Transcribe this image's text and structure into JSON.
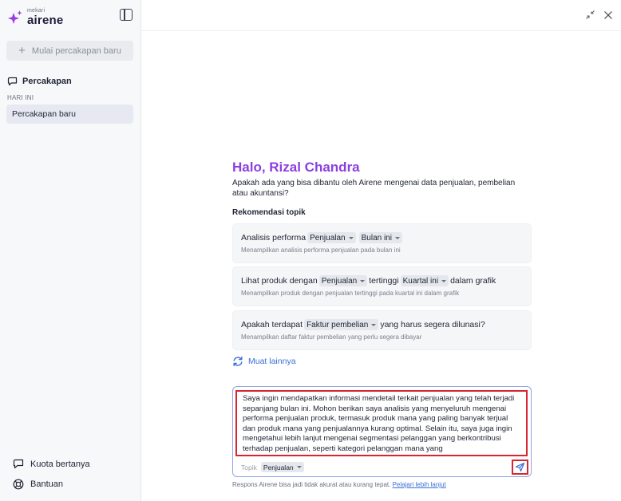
{
  "brand": {
    "small": "mekari",
    "name": "airene",
    "accent": "#8b3fe0"
  },
  "sidebar": {
    "new_chat_label": "Mulai percakapan baru",
    "section_label": "Percakapan",
    "group_label": "HARI INI",
    "conversations": [
      "Percakapan baru"
    ],
    "bottom": {
      "quota_label": "Kuota bertanya",
      "help_label": "Bantuan"
    }
  },
  "main": {
    "greeting": "Halo, Rizal Chandra",
    "subtitle": "Apakah ada yang bisa dibantu oleh Airene mengenai data penjualan, pembelian atau akuntansi?",
    "rec_title": "Rekomendasi topik",
    "cards": [
      {
        "p1": "Analisis performa",
        "chip1": "Penjualan",
        "chip2": "Bulan ini",
        "desc": "Menampilkan analisis performa penjualan pada bulan ini"
      },
      {
        "p1": "Lihat produk dengan",
        "chip1": "Penjualan",
        "p2": "tertinggi",
        "chip2": "Kuartal ini",
        "p3": "dalam grafik",
        "desc": "Menampilkan produk dengan penjualan tertinggi pada kuartal ini dalam grafik"
      },
      {
        "p1": "Apakah terdapat",
        "chip1": "Faktur pembelian",
        "p2": "yang harus segera dilunasi?",
        "desc": "Menampilkan daftar faktur pembelian yang perlu segera dibayar"
      }
    ],
    "load_more": "Muat lainnya",
    "composer": {
      "value": "Saya ingin mendapatkan informasi mendetail terkait penjualan yang telah terjadi sepanjang bulan ini. Mohon berikan saya analisis yang menyeluruh mengenai performa penjualan produk, termasuk produk mana yang paling banyak terjual dan produk mana yang penjualannya kurang optimal. Selain itu, saya juga ingin mengetahui lebih lanjut mengenai segmentasi pelanggan yang berkontribusi terhadap penjualan, seperti kategori pelanggan mana yang",
      "topic_label": "Topik",
      "topic_value": "Penjualan"
    },
    "disclaimer": "Respons Airene bisa jadi tidak akurat atau kurang tepat.",
    "learn_more": "Pelajari lebih lanjut"
  }
}
